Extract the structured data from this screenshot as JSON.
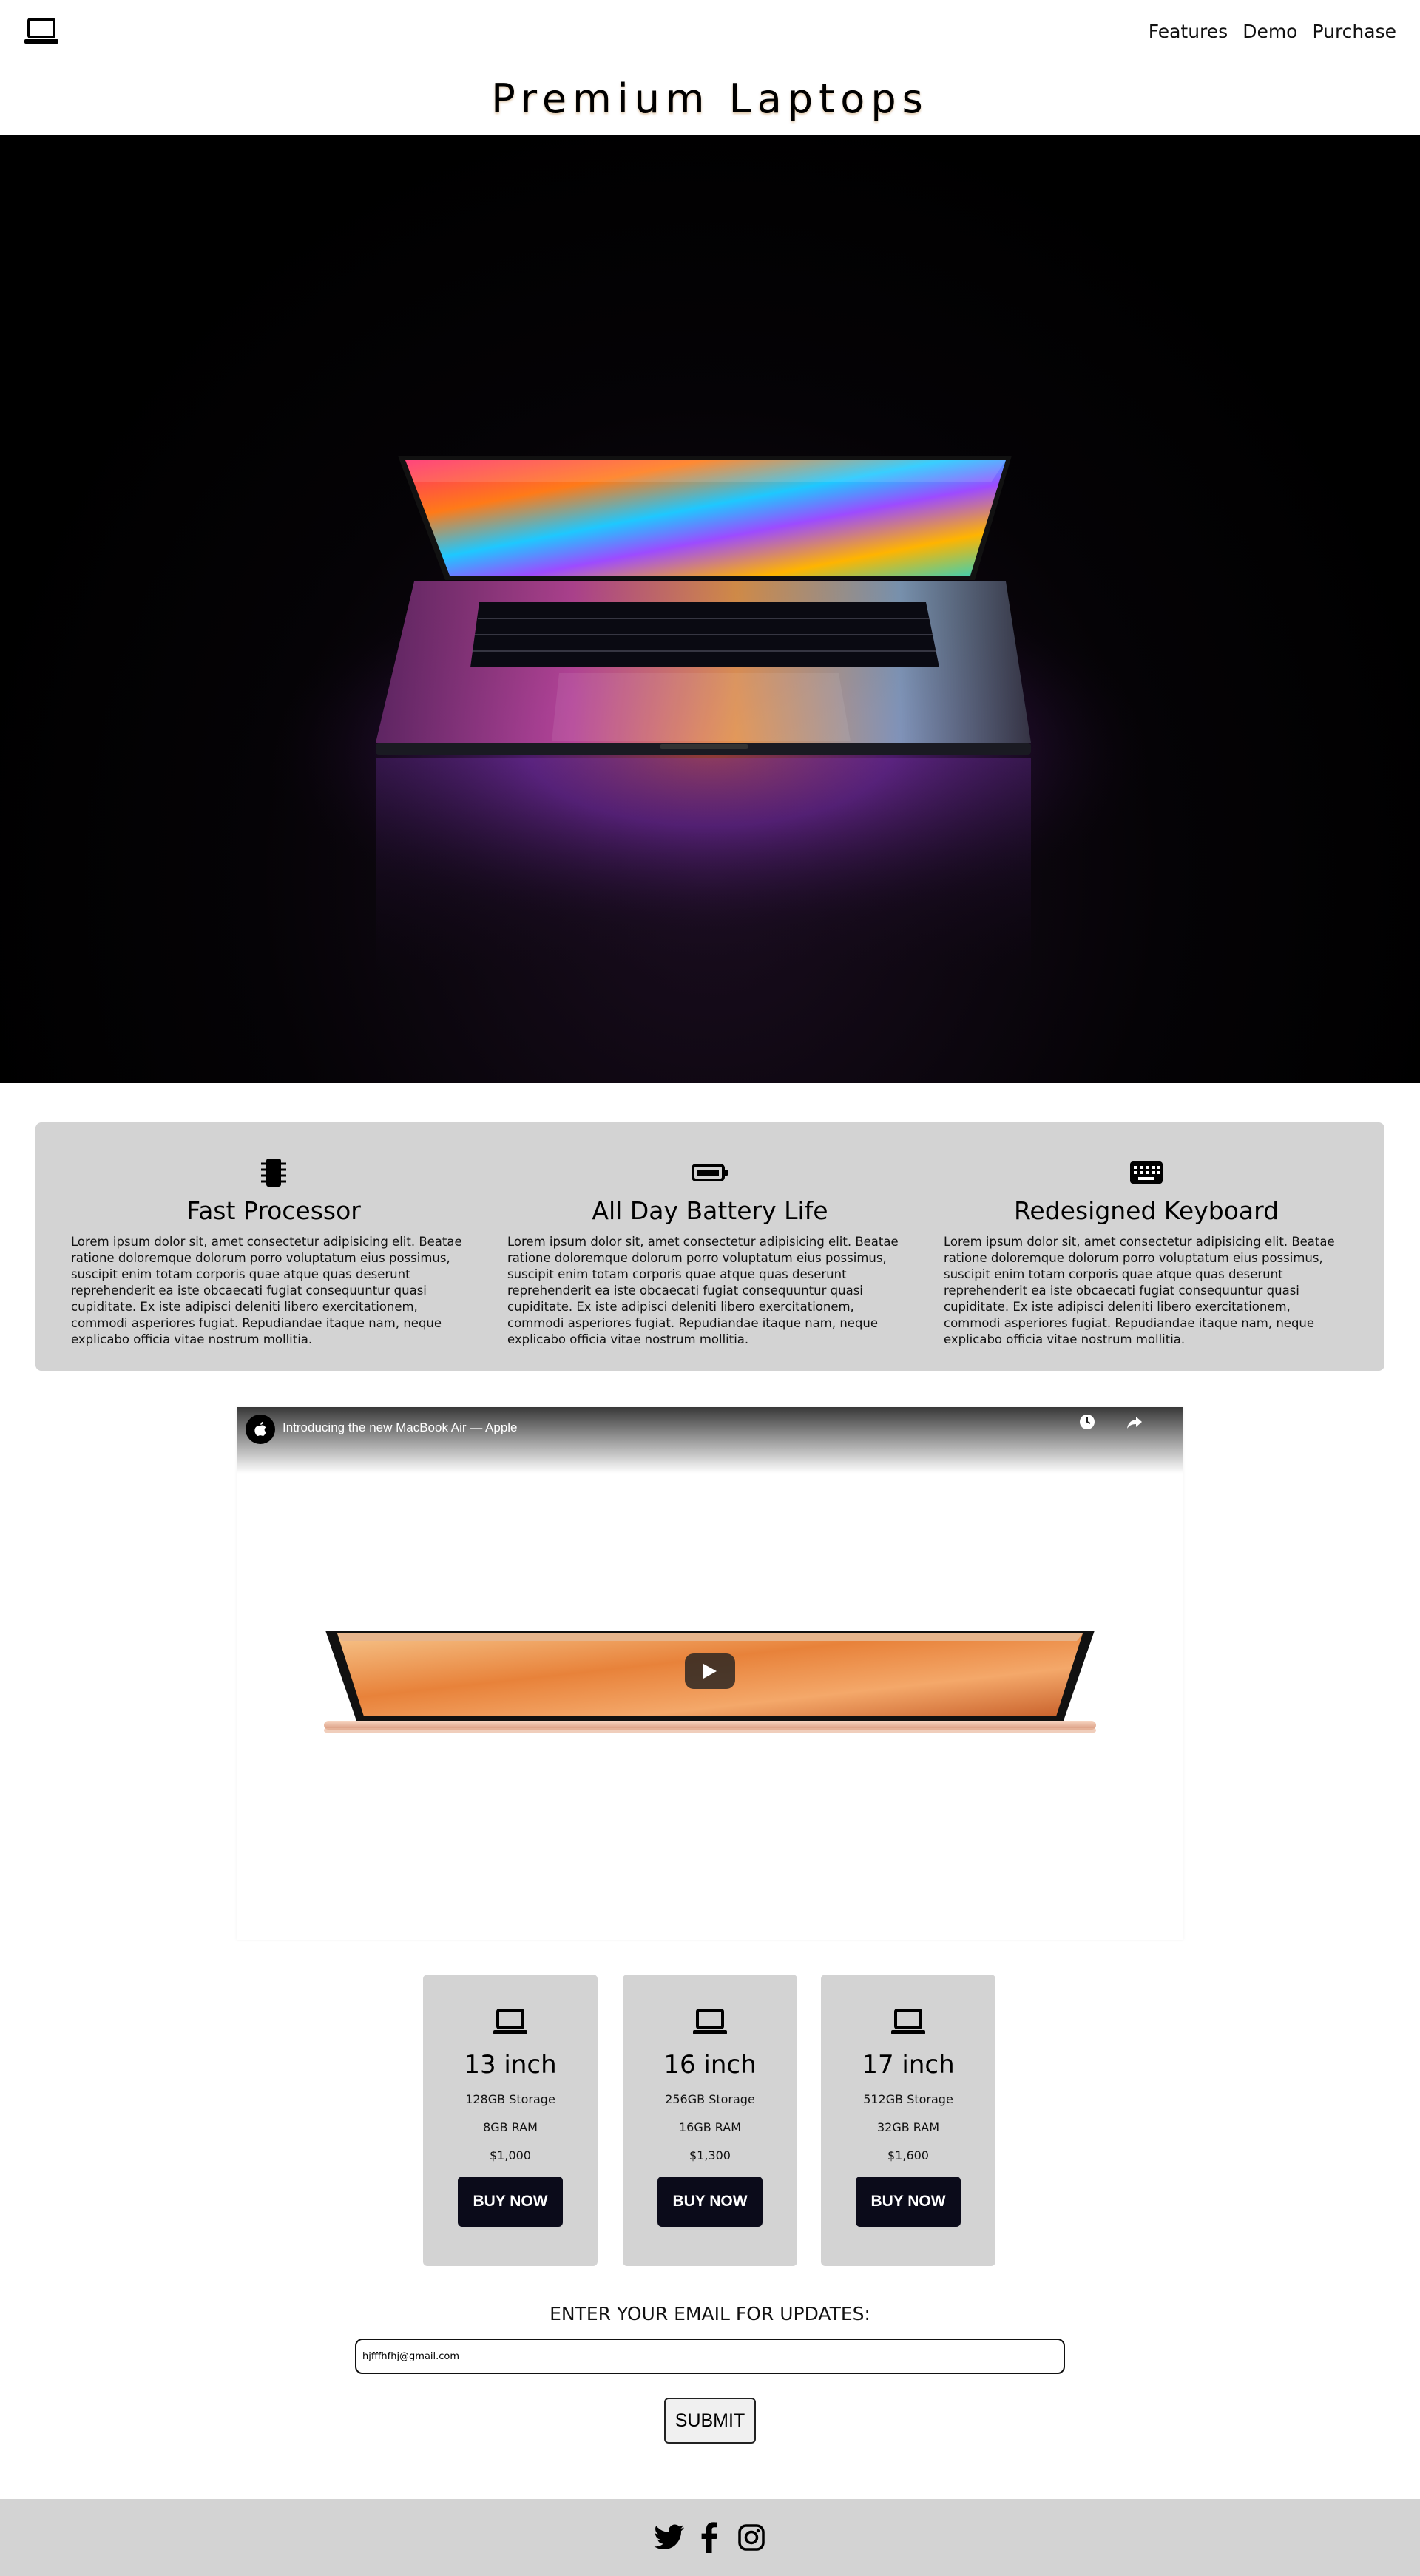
{
  "nav": {
    "logo_icon": "laptop-icon",
    "links": [
      "Features",
      "Demo",
      "Purchase"
    ]
  },
  "title": "Premium Laptops",
  "hero": {
    "image": "laptop-on-dark-background-photo"
  },
  "features": [
    {
      "icon": "microchip-icon",
      "heading": "Fast Processor",
      "text": "Lorem ipsum dolor sit, amet consectetur adipisicing elit. Beatae ratione doloremque dolorum porro voluptatum eius possimus, suscipit enim totam corporis quae atque quas deserunt reprehenderit ea iste obcaecati fugiat consequuntur quasi cupiditate. Ex iste adipisci deleniti libero exercitationem, commodi asperiores fugiat. Repudiandae itaque nam, neque explicabo officia vitae nostrum mollitia."
    },
    {
      "icon": "battery-full-icon",
      "heading": "All Day Battery Life",
      "text": "Lorem ipsum dolor sit, amet consectetur adipisicing elit. Beatae ratione doloremque dolorum porro voluptatum eius possimus, suscipit enim totam corporis quae atque quas deserunt reprehenderit ea iste obcaecati fugiat consequuntur quasi cupiditate. Ex iste adipisci deleniti libero exercitationem, commodi asperiores fugiat. Repudiandae itaque nam, neque explicabo officia vitae nostrum mollitia."
    },
    {
      "icon": "keyboard-icon",
      "heading": "Redesigned Keyboard",
      "text": "Lorem ipsum dolor sit, amet consectetur adipisicing elit. Beatae ratione doloremque dolorum porro voluptatum eius possimus, suscipit enim totam corporis quae atque quas deserunt reprehenderit ea iste obcaecati fugiat consequuntur quasi cupiditate. Ex iste adipisci deleniti libero exercitationem, commodi asperiores fugiat. Repudiandae itaque nam, neque explicabo officia vitae nostrum mollitia."
    }
  ],
  "video": {
    "title": "Introducing the new MacBook Air — Apple",
    "channel_icon": "apple-logo-icon",
    "watch_later_icon": "clock-icon",
    "share_icon": "share-icon",
    "play_icon": "play-icon"
  },
  "plans": [
    {
      "icon": "laptop-icon",
      "name": "13 inch",
      "storage": "128GB Storage",
      "ram": "8GB RAM",
      "price": "$1,000",
      "button": "BUY NOW"
    },
    {
      "icon": "laptop-icon",
      "name": "16 inch",
      "storage": "256GB Storage",
      "ram": "16GB RAM",
      "price": "$1,300",
      "button": "BUY NOW"
    },
    {
      "icon": "laptop-icon",
      "name": "17 inch",
      "storage": "512GB Storage",
      "ram": "32GB RAM",
      "price": "$1,600",
      "button": "BUY NOW"
    }
  ],
  "email": {
    "label": "ENTER YOUR EMAIL FOR UPDATES:",
    "value": "hjfffhfhj@gmail.com",
    "submit": "SUBMIT"
  },
  "footer": {
    "social_icons": [
      "twitter-icon",
      "facebook-icon",
      "instagram-icon"
    ]
  },
  "colors": {
    "panel_gray": "#d3d3d3",
    "button_dark": "#0b0b1a",
    "hero_bg": "#000000"
  }
}
